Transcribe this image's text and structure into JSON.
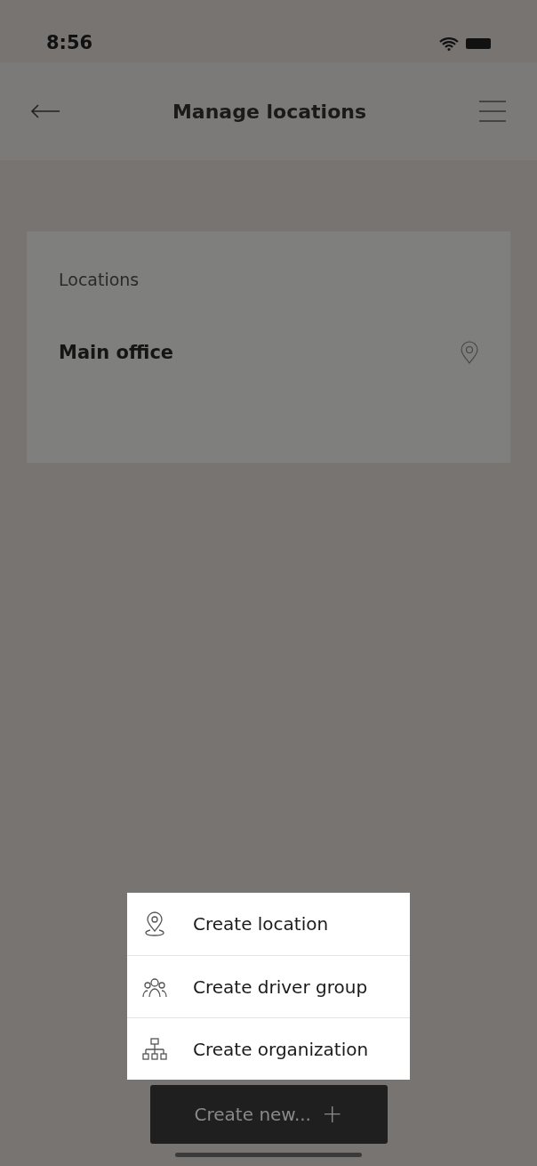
{
  "status_bar": {
    "time": "8:56"
  },
  "header": {
    "title": "Manage locations"
  },
  "locations": {
    "heading": "Locations",
    "items": [
      {
        "name": "Main office"
      }
    ]
  },
  "menu": [
    {
      "kind": "location",
      "label": "Create location"
    },
    {
      "kind": "group",
      "label": "Create driver group"
    },
    {
      "kind": "organization",
      "label": "Create organization"
    }
  ],
  "create_button": {
    "label": "Create new...",
    "icon": "+"
  }
}
